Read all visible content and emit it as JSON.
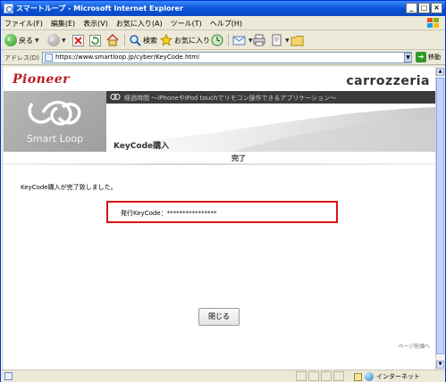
{
  "window": {
    "title": "スマートループ - Microsoft Internet Explorer",
    "controls": [
      "_",
      "□",
      "×"
    ]
  },
  "menu": [
    "ファイル(F)",
    "編集(E)",
    "表示(V)",
    "お気に入り(A)",
    "ツール(T)",
    "ヘルプ(H)"
  ],
  "toolbar": {
    "back": "戻る",
    "search": "検索",
    "favorites": "お気に入り"
  },
  "address": {
    "label": "アドレス(D)",
    "url": "https://www.smartloop.jp/cyber/KeyCode.html",
    "go": "移動"
  },
  "page": {
    "brand_left": "Pioneer",
    "brand_right": "carrozzeria",
    "band_text": "経過時間 ～iPhoneやiPod touchでリモコン操作できるアプリケーション～",
    "smartloop_text": "Smart Loop",
    "heading": "KeyCode購入",
    "step": "完了",
    "message": "KeyCode購入が完了致しました。",
    "keycode_label": "発行KeyCode：",
    "keycode_value": "****************",
    "close_button": "閉じる",
    "footer": "ページ先頭へ"
  },
  "status": {
    "zone": "インターネット"
  },
  "colors": {
    "accent_red": "#d9141a",
    "pioneer_red": "#b81c22"
  }
}
